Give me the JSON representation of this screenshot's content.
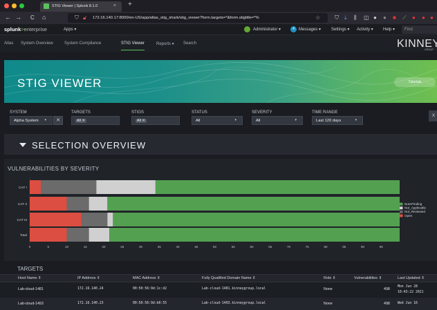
{
  "browser": {
    "tab_title": "STIG Viewer | Splunk 8.1.0",
    "tab_close": "×",
    "new_tab": "+",
    "back": "←",
    "forward": "→",
    "reload": "C",
    "home": "⌂",
    "url": "172.16.140.17:8000/en-US/app/atlas_stig_shark/stig_viewer?form.targets=*&form.stigtitle=*%",
    "star": "☆"
  },
  "splunk": {
    "logo_main": "splunk",
    "logo_gt": ">",
    "logo_sub": "enterprise",
    "apps": "Apps ▾",
    "admin": "Administrator ▾",
    "messages_count": "4",
    "messages": "Messages ▾",
    "settings": "Settings ▾",
    "activity": "Activity ▾",
    "help": "Help ▾",
    "find": "Find"
  },
  "appnav": {
    "items": [
      "Atlas",
      "System Overview",
      "System Compliance",
      "STIG Viewer",
      "Reports ▾",
      "Search"
    ],
    "active": "STIG Viewer",
    "brand": "KINNEY",
    "brand_sub": "GROUP"
  },
  "banner": {
    "title": "STIG VIEWER",
    "tutorials": "Tutorials"
  },
  "filters": {
    "system_label": "SYSTEM",
    "system_value": "Alpha System",
    "system_caret": "▾",
    "system_clear": "✕",
    "targets_label": "TARGETS",
    "targets_chip": "All ✕",
    "stigs_label": "STIGS",
    "stigs_chip": "All ✕",
    "status_label": "STATUS",
    "status_value": "All",
    "status_caret": "▾",
    "severity_label": "SEVERITY",
    "severity_value": "All",
    "severity_caret": "▾",
    "timerange_label": "TIME RANGE",
    "timerange_value": "Last 120 days",
    "timerange_caret": "▾",
    "close": "X"
  },
  "section": {
    "title": "SELECTION OVERVIEW"
  },
  "chart_data": {
    "type": "bar",
    "orientation": "horizontal",
    "stacked": true,
    "title": "VULNERABILITIES BY SEVERITY",
    "categories": [
      "CAT I",
      "CAT II",
      "CAT III",
      "Total"
    ],
    "series": [
      {
        "name": "Open",
        "color": "#dc4e41",
        "values": [
          3,
          10,
          14,
          10
        ]
      },
      {
        "name": "Not_Reviewed",
        "color": "#6b6b6b",
        "values": [
          15,
          6,
          7,
          6
        ]
      },
      {
        "name": "Not_Applicable",
        "color": "#d0d0d0",
        "values": [
          16,
          5,
          1.5,
          5.5
        ]
      },
      {
        "name": "NotAFinding",
        "color": "#53a051",
        "values": [
          66,
          79,
          77.5,
          78.5
        ]
      }
    ],
    "xticks": [
      0,
      5,
      10,
      15,
      20,
      25,
      30,
      35,
      40,
      45,
      50,
      55,
      60,
      65,
      70,
      75,
      80,
      85,
      90,
      95
    ],
    "xlim": [
      0,
      100
    ],
    "legend": "right",
    "legend_order": [
      "NotAFinding",
      "Not_Applicable",
      "Not_Reviewed",
      "Open"
    ]
  },
  "targets": {
    "title": "TARGETS",
    "columns": [
      "Host Name ⇕",
      "IP Address ⇕",
      "MAC Address ⇕",
      "Fully Qualified Domain Name ⇕",
      "Role ⇕",
      "Vulnerabilities ⇕",
      "Last Updated ⇕"
    ],
    "rows": [
      {
        "host": "Lab-cloud-1481",
        "ip": "172.16.140.24",
        "mac": "00:50:56:9d:1c:d2",
        "fqdn": "Lab-cloud-1481.kinneygroup.local",
        "role": "None",
        "vulns": "498",
        "updated": "Mon Jun 28",
        "updated2": "10:43:22 2021"
      },
      {
        "host": "Lab-cloud-1493",
        "ip": "172.16.140.23",
        "mac": "00:50:56:9d:b0:55",
        "fqdn": "Lab-cloud-1493.kinneygroup.local",
        "role": "None",
        "vulns": "498",
        "updated": "Wed Jun 16",
        "updated2": ""
      }
    ]
  },
  "colors": {
    "accent": "#5cc05c",
    "bg": "#1a1c21"
  }
}
